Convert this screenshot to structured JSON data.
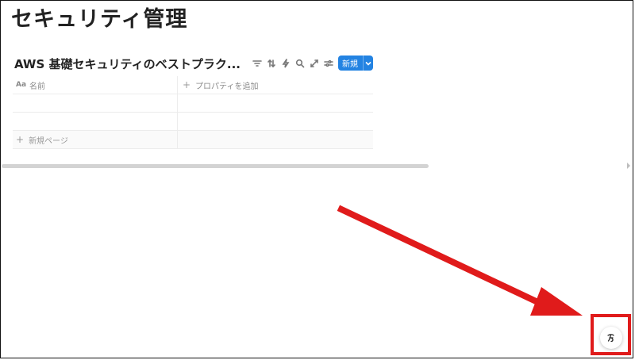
{
  "page": {
    "title": "セキュリティ管理"
  },
  "database": {
    "title": "AWS 基礎セキュリティのベストプラク...",
    "new_button_label": "新規",
    "toolbar_icons": [
      "filter-icon",
      "sort-icon",
      "automation-bolt-icon",
      "search-icon",
      "expand-icon",
      "settings-sliders-icon"
    ]
  },
  "table": {
    "columns": [
      {
        "icon": "Aa",
        "label": "名前"
      },
      {
        "icon": "+",
        "label": "プロパティを追加"
      }
    ],
    "rows": [
      [
        "",
        ""
      ],
      [
        "",
        ""
      ]
    ],
    "new_page": {
      "icon": "+",
      "label": "新規ページ"
    }
  },
  "help": {
    "icon": "notion-help-icon"
  },
  "annotation": {
    "color": "#e01b1b"
  }
}
